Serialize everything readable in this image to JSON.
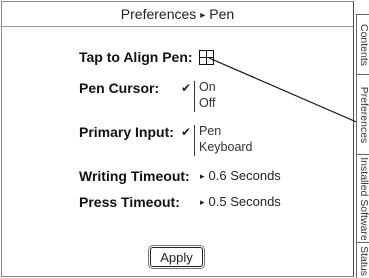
{
  "window": {
    "title_section": "Preferences",
    "title_page": "Pen",
    "title_separator": "▸"
  },
  "settings": {
    "tap_align": {
      "label": "Tap to Align Pen:"
    },
    "pen_cursor": {
      "label": "Pen Cursor:",
      "check": "✔",
      "options": [
        "On",
        "Off"
      ],
      "selected": "On"
    },
    "primary_input": {
      "label": "Primary Input:",
      "check": "✔",
      "options": [
        "Pen",
        "Keyboard"
      ],
      "selected": "Pen"
    },
    "writing_timeout": {
      "label": "Writing Timeout:",
      "value": "0.6 Seconds"
    },
    "press_timeout": {
      "label": "Press Timeout:",
      "value": "0.5 Seconds"
    },
    "arrow": "▸"
  },
  "buttons": {
    "apply": "Apply"
  },
  "tabs": [
    "Contents",
    "Preferences",
    "Installed Software",
    "Status"
  ]
}
